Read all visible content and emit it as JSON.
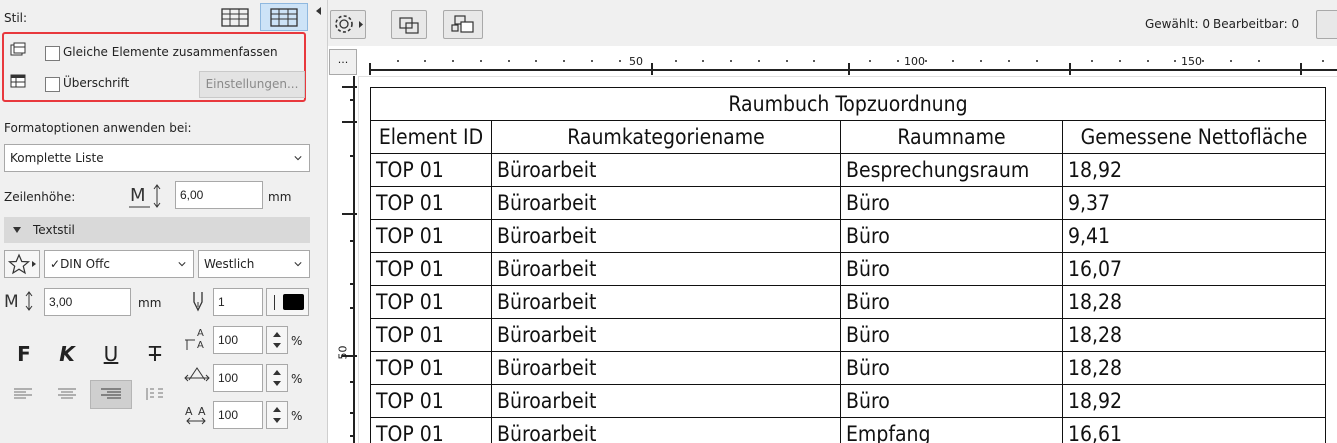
{
  "left_panel": {
    "stil_label": "Stil:",
    "merge_checkbox_label": "Gleiche Elemente zusammenfassen",
    "merge_checked": false,
    "heading_checkbox_label": "Überschrift",
    "heading_checked": false,
    "settings_button": "Einstellungen...",
    "format_apply_label": "Formatoptionen anwenden bei:",
    "format_apply_value": "Komplette Liste",
    "row_height_label": "Zeilenhöhe:",
    "row_height_value": "6,00",
    "row_height_unit": "mm",
    "textstyle_section": "Textstil",
    "font_value": "DIN Offc",
    "font_check": "✓",
    "script_value": "Westlich",
    "text_size_value": "3,00",
    "text_size_unit": "mm",
    "pen_value": "1",
    "bold_label": "F",
    "italic_label": "K",
    "underline_label": "U",
    "strike_label": "T",
    "char_spacing_value": "100",
    "width_value": "100",
    "line_spacing_value": "100",
    "percent": "%",
    "accent_highlight": "#e8383d"
  },
  "toolbar": {
    "selected_label": "Gewählt: 0",
    "editable_label": "Bearbeitbar: 0"
  },
  "ruler": {
    "corner_button": "...",
    "h_labels": [
      "50",
      "100",
      "150"
    ],
    "v_label": "50"
  },
  "schedule": {
    "title": "Raumbuch Topzuordnung",
    "columns": [
      "Element ID",
      "Raumkategoriename",
      "Raumname",
      "Gemessene Nettofläche"
    ],
    "rows": [
      [
        "TOP 01",
        "Büroarbeit",
        "Besprechungsraum",
        "18,92"
      ],
      [
        "TOP 01",
        "Büroarbeit",
        "Büro",
        "9,37"
      ],
      [
        "TOP 01",
        "Büroarbeit",
        "Büro",
        "9,41"
      ],
      [
        "TOP 01",
        "Büroarbeit",
        "Büro",
        "16,07"
      ],
      [
        "TOP 01",
        "Büroarbeit",
        "Büro",
        "18,28"
      ],
      [
        "TOP 01",
        "Büroarbeit",
        "Büro",
        "18,28"
      ],
      [
        "TOP 01",
        "Büroarbeit",
        "Büro",
        "18,28"
      ],
      [
        "TOP 01",
        "Büroarbeit",
        "Büro",
        "18,92"
      ],
      [
        "TOP 01",
        "Büroarbeit",
        "Empfang",
        "16,61"
      ]
    ]
  }
}
